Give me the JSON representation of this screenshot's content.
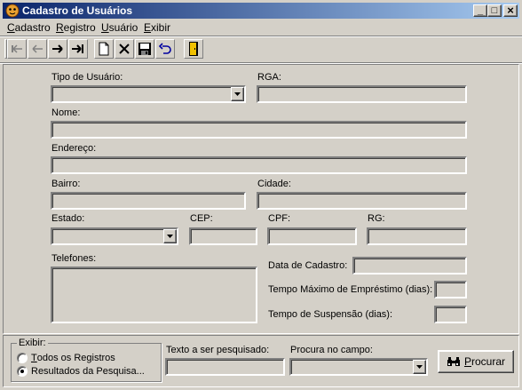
{
  "window": {
    "title": "Cadastro de Usuários",
    "minimize_glyph": "_",
    "maximize_glyph": "□",
    "close_glyph": "×"
  },
  "menu": [
    {
      "label": "adastro",
      "mnemonic": "C"
    },
    {
      "label": "egistro",
      "mnemonic": "R"
    },
    {
      "label": "suário",
      "mnemonic": "U"
    },
    {
      "label": "xibir",
      "mnemonic": "E"
    }
  ],
  "toolbar": {
    "icons": [
      "first-record-icon",
      "previous-record-icon",
      "next-record-icon",
      "last-record-icon",
      "new-record-icon",
      "delete-record-icon",
      "save-record-icon",
      "undo-icon",
      "exit-door-icon"
    ]
  },
  "form": {
    "tipo_usuario_label": "Tipo de Usuário:",
    "rga_label": "RGA:",
    "nome_label": "Nome:",
    "endereco_label": "Endereço:",
    "bairro_label": "Bairro:",
    "cidade_label": "Cidade:",
    "estado_label": "Estado:",
    "cep_label": "CEP:",
    "cpf_label": "CPF:",
    "rg_label": "RG:",
    "telefones_label": "Telefones:",
    "data_cadastro_label": "Data de Cadastro:",
    "tempo_emprestimo_label": "Tempo Máximo de Empréstimo (dias):",
    "tempo_suspensao_label": "Tempo de Suspensão (dias):",
    "values": {
      "tipo_usuario": "",
      "rga": "",
      "nome": "",
      "endereco": "",
      "bairro": "",
      "cidade": "",
      "estado": "",
      "cep": "",
      "cpf": "",
      "rg": "",
      "telefones": "",
      "data_cadastro": "",
      "tempo_emprestimo": "",
      "tempo_suspensao": ""
    }
  },
  "search": {
    "group_title": "Exibir:",
    "option_all_mnemonic": "T",
    "option_all_label": "odos os Registros",
    "option_results_label": "Resultados da Pesquisa...",
    "selected_option": "Resultados da Pesquisa...",
    "text_label": "Texto a ser pesquisado:",
    "text_value": "",
    "field_label": "Procura no campo:",
    "field_value": "",
    "button_mnemonic": "P",
    "button_label": "rocurar"
  }
}
